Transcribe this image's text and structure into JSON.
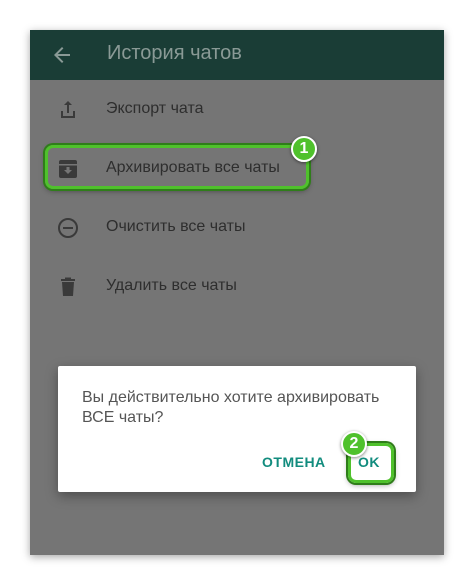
{
  "appbar": {
    "title": "История чатов"
  },
  "menu": {
    "items": [
      {
        "label": "Экспорт чата",
        "icon": "share-icon"
      },
      {
        "label": "Архивировать все чаты",
        "icon": "archive-icon"
      },
      {
        "label": "Очистить все чаты",
        "icon": "minus-circle-icon"
      },
      {
        "label": "Удалить все чаты",
        "icon": "trash-icon"
      }
    ]
  },
  "dialog": {
    "message": "Вы действительно хотите архивировать ВСЕ чаты?",
    "cancel_label": "ОТМЕНА",
    "ok_label": "OK"
  },
  "annotations": {
    "step1": "1",
    "step2": "2"
  },
  "colors": {
    "appbar": "#1a3d36",
    "overlay": "#757575",
    "accent": "#128c7e",
    "highlight": "#4fc12c"
  }
}
